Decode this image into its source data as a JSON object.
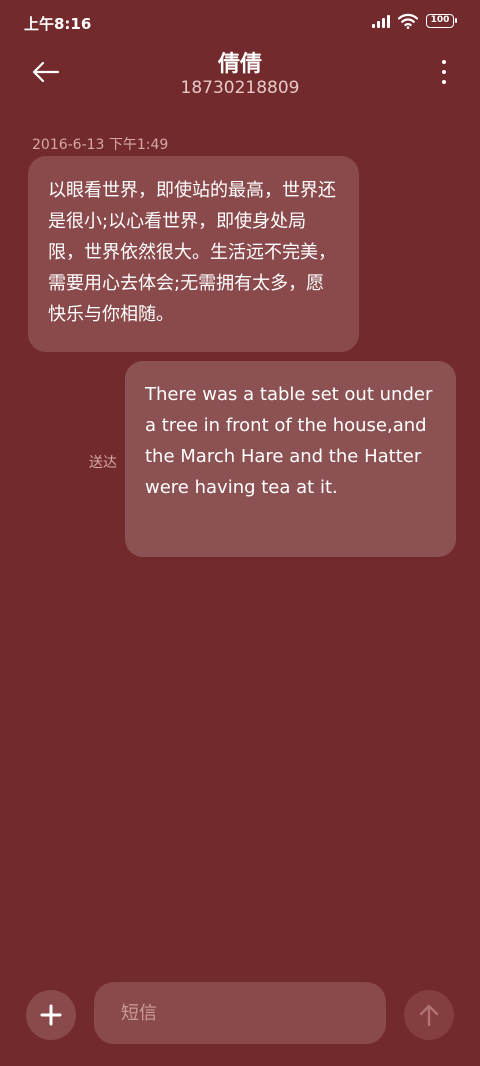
{
  "status_bar": {
    "time": "上午8:16",
    "battery": "100"
  },
  "header": {
    "contact_name": "倩倩",
    "contact_number": "18730218809"
  },
  "messages": [
    {
      "timestamp": "2016-6-13 下午1:49",
      "direction": "incoming",
      "text": "以眼看世界，即使站的最高，世界还是很小;以心看世界，即使身处局限，世界依然很大。生活远不完美，需要用心去体会;无需拥有太多，愿快乐与你相随。"
    },
    {
      "direction": "outgoing",
      "status": "送达",
      "text": "There was a table set out under a tree in front of the house,and the March Hare and the Hatter were having tea at it."
    }
  ],
  "composer": {
    "placeholder": "短信"
  },
  "icons": {
    "back": "back-arrow-icon",
    "more": "more-vertical-icon",
    "add": "plus-icon",
    "send": "arrow-up-icon",
    "signal": "signal-icon",
    "wifi": "wifi-icon",
    "battery": "battery-icon"
  },
  "colors": {
    "background": "#732a2c",
    "bubble": "#8a4a4b",
    "secondary_text": "#d6a8a8"
  }
}
